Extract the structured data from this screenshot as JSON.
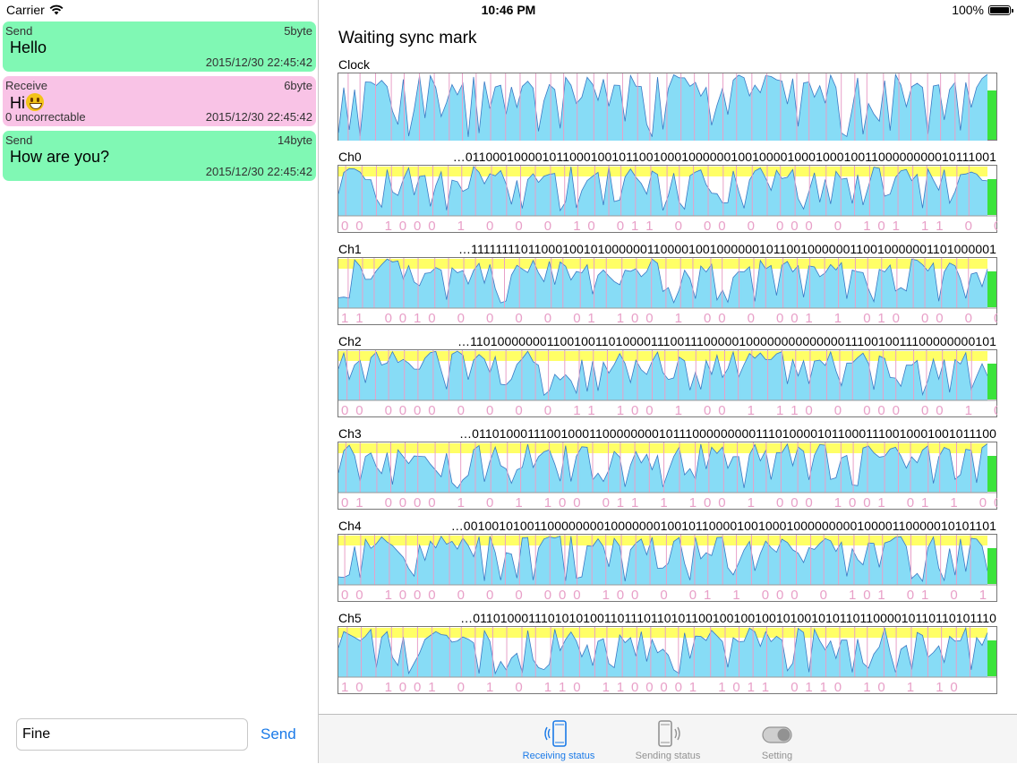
{
  "status_bar": {
    "carrier": "Carrier",
    "time": "10:46 PM",
    "battery": "100%"
  },
  "messages": [
    {
      "direction": "Send",
      "size": "5byte",
      "text": "Hello",
      "note": "",
      "timestamp": "2015/12/30 22:45:42",
      "kind": "send"
    },
    {
      "direction": "Receive",
      "size": "6byte",
      "text": "Hi",
      "emoji": "smiley-emoji",
      "note": "0 uncorrectable",
      "timestamp": "2015/12/30 22:45:42",
      "kind": "receive"
    },
    {
      "direction": "Send",
      "size": "14byte",
      "text": "How are you?",
      "note": "",
      "timestamp": "2015/12/30 22:45:42",
      "kind": "send"
    }
  ],
  "composer": {
    "value": "Fine",
    "send_label": "Send"
  },
  "main": {
    "title": "Waiting sync mark",
    "clock_label": "Clock",
    "channels": [
      {
        "label": "Ch0",
        "bits": "…0110001000010110001001011001000100000010010000100010001001100000000010111001",
        "decoded": [
          "0",
          "0",
          "",
          "1",
          "0",
          "0",
          "0",
          "",
          "1",
          "",
          "0",
          "",
          "0",
          "",
          "0",
          "",
          "1",
          "0",
          "",
          "0",
          "1",
          "1",
          "",
          "0",
          "",
          "0",
          "0",
          "",
          "0",
          "",
          "0",
          "0",
          "0",
          "",
          "0",
          "",
          "1",
          "0",
          "1",
          "",
          "1",
          "1",
          "",
          "0",
          "",
          "0",
          "1"
        ]
      },
      {
        "label": "Ch1",
        "bits": "…1111111101100010010100000011000010010000001011001000000110010000001101000001",
        "decoded": [
          "1",
          "1",
          "",
          "0",
          "0",
          "1",
          "0",
          "",
          "0",
          "",
          "0",
          "",
          "0",
          "",
          "0",
          "",
          "0",
          "1",
          "",
          "1",
          "0",
          "0",
          "",
          "1",
          "",
          "0",
          "0",
          "",
          "0",
          "",
          "0",
          "0",
          "1",
          "",
          "1",
          "",
          "0",
          "1",
          "0",
          "",
          "0",
          "0",
          "",
          "0",
          "",
          "0",
          "1"
        ]
      },
      {
        "label": "Ch2",
        "bits": "…1101000000011001001101000011100111000001000000000000001110010011100000000101",
        "decoded": [
          "0",
          "0",
          "",
          "0",
          "0",
          "0",
          "0",
          "",
          "0",
          "",
          "0",
          "",
          "0",
          "",
          "0",
          "",
          "1",
          "1",
          "",
          "1",
          "0",
          "0",
          "",
          "1",
          "",
          "0",
          "0",
          "",
          "1",
          "",
          "1",
          "1",
          "0",
          "",
          "0",
          "",
          "0",
          "0",
          "0",
          "",
          "0",
          "0",
          "",
          "1",
          "",
          "0",
          "1"
        ]
      },
      {
        "label": "Ch3",
        "bits": "…0110100011100100011000000001011100000000011101000010110001110010001001011100",
        "decoded": [
          "0",
          "1",
          "",
          "0",
          "0",
          "0",
          "0",
          "",
          "1",
          "",
          "0",
          "",
          "1",
          "",
          "1",
          "0",
          "0",
          "",
          "0",
          "1",
          "1",
          "",
          "1",
          "",
          "1",
          "0",
          "0",
          "",
          "1",
          "",
          "0",
          "0",
          "0",
          "",
          "1",
          "0",
          "0",
          "1",
          "",
          "0",
          "1",
          "",
          "1",
          "",
          "0",
          "0"
        ]
      },
      {
        "label": "Ch4",
        "bits": "…0010010100110000000010000000100101100001001000100000000010000110000010101101",
        "decoded": [
          "0",
          "0",
          "",
          "1",
          "0",
          "0",
          "0",
          "",
          "0",
          "",
          "0",
          "",
          "0",
          "",
          "0",
          "0",
          "0",
          "",
          "1",
          "0",
          "0",
          "",
          "0",
          "",
          "0",
          "1",
          "",
          "1",
          "",
          "0",
          "0",
          "0",
          "",
          "0",
          "",
          "1",
          "0",
          "1",
          "",
          "0",
          "1",
          "",
          "0",
          "",
          "1"
        ]
      },
      {
        "label": "Ch5",
        "bits": "…0110100011101010100110111011010110010010010010100101011011000010110110101110",
        "decoded": [
          "1",
          "0",
          "",
          "1",
          "0",
          "0",
          "1",
          "",
          "0",
          "",
          "1",
          "",
          "0",
          "",
          "1",
          "1",
          "0",
          "",
          "1",
          "1",
          "0",
          "0",
          "0",
          "0",
          "1",
          "",
          "1",
          "0",
          "1",
          "1",
          "",
          "0",
          "1",
          "1",
          "0",
          "",
          "1",
          "0",
          "",
          "1",
          "",
          "1",
          "0"
        ]
      }
    ]
  },
  "tabs": [
    {
      "label": "Receiving status",
      "icon": "phone-receive-icon",
      "active": true
    },
    {
      "label": "Sending status",
      "icon": "phone-send-icon",
      "active": false
    },
    {
      "label": "Setting",
      "icon": "toggle-switch-icon",
      "active": false
    }
  ],
  "colors": {
    "send_bubble": "#80f8b4",
    "receive_bubble": "#f9c3e6",
    "waveform_fill": "#87dcf6",
    "waveform_line": "#3b78c4",
    "threshold_band": "#ffff66",
    "level_bar": "#3be33b",
    "bit_marker": "#e8a0c8",
    "accent": "#1a7ae8"
  }
}
